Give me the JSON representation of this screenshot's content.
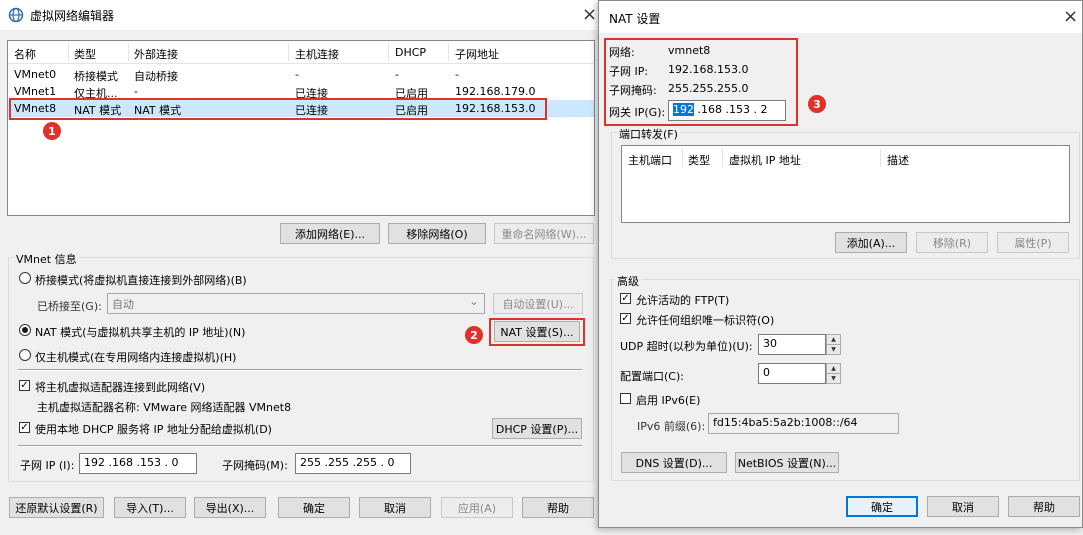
{
  "left": {
    "title": "虚拟网络编辑器",
    "close": "×",
    "table": {
      "headers": [
        "名称",
        "类型",
        "外部连接",
        "主机连接",
        "DHCP",
        "子网地址"
      ],
      "rows": [
        [
          "VMnet0",
          "桥接模式",
          "自动桥接",
          "-",
          "-",
          "-"
        ],
        [
          "VMnet1",
          "仅主机...",
          "-",
          "已连接",
          "已启用",
          "192.168.179.0"
        ],
        [
          "VMnet8",
          "NAT 模式",
          "NAT 模式",
          "已连接",
          "已启用",
          "192.168.153.0"
        ]
      ]
    },
    "buttons": {
      "add": "添加网络(E)...",
      "remove": "移除网络(O)",
      "rename": "重命名网络(W)...",
      "auto": "自动设置(U)...",
      "nat": "NAT 设置(S)...",
      "dhcp": "DHCP 设置(P)...",
      "restore": "还原默认设置(R)",
      "import": "导入(T)...",
      "export": "导出(X)...",
      "ok": "确定",
      "cancel": "取消",
      "apply": "应用(A)",
      "help": "帮助"
    },
    "info_title": "VMnet 信息",
    "bridge": "桥接模式(将虚拟机直接连接到外部网络)(B)",
    "bridge_to_label": "已桥接至(G):",
    "bridge_to_value": "自动",
    "nat_mode": "NAT 模式(与虚拟机共享主机的 IP 地址)(N)",
    "host_only": "仅主机模式(在专用网络内连接虚拟机)(H)",
    "connect_adapter": "将主机虚拟适配器连接到此网络(V)",
    "adapter_name": "主机虚拟适配器名称: VMware 网络适配器 VMnet8",
    "use_dhcp": "使用本地 DHCP 服务将 IP 地址分配给虚拟机(D)",
    "subnet_ip_label": "子网 IP (I):",
    "subnet_ip": "192 .168 .153 . 0",
    "mask_label": "子网掩码(M):",
    "mask": "255 .255 .255 . 0",
    "badge1": "1",
    "badge2": "2"
  },
  "right": {
    "title": "NAT 设置",
    "close": "×",
    "network_label": "网络:",
    "network": "vmnet8",
    "subnet_label": "子网 IP:",
    "subnet": "192.168.153.0",
    "mask_label": "子网掩码:",
    "mask": "255.255.255.0",
    "gateway_label": "网关 IP(G):",
    "gateway_sel": "192",
    "gateway_rest": " .168 .153 . 2",
    "badge3": "3",
    "port_fwd": "端口转发(F)",
    "pf_headers": [
      "主机端口",
      "类型",
      "虚拟机 IP 地址",
      "描述"
    ],
    "pf_add": "添加(A)...",
    "pf_remove": "移除(R)",
    "pf_props": "属性(P)",
    "advanced": "高级",
    "allow_ftp": "允许活动的 FTP(T)",
    "allow_uid": "允许任何组织唯一标识符(O)",
    "udp_label": "UDP 超时(以秒为单位)(U):",
    "udp_value": "30",
    "cfg_port_label": "配置端口(C):",
    "cfg_port_value": "0",
    "ipv6_enable": "启用 IPv6(E)",
    "ipv6_prefix_label": "IPv6 前缀(6):",
    "ipv6_prefix": "fd15:4ba5:5a2b:1008::/64",
    "dns": "DNS 设置(D)...",
    "netbios": "NetBIOS 设置(N)...",
    "ok": "确定",
    "cancel": "取消",
    "help": "帮助"
  },
  "icons": {
    "app": "network-globe-icon",
    "check": "✓",
    "up": "▲",
    "down": "▼",
    "dropdown": "⌄"
  }
}
